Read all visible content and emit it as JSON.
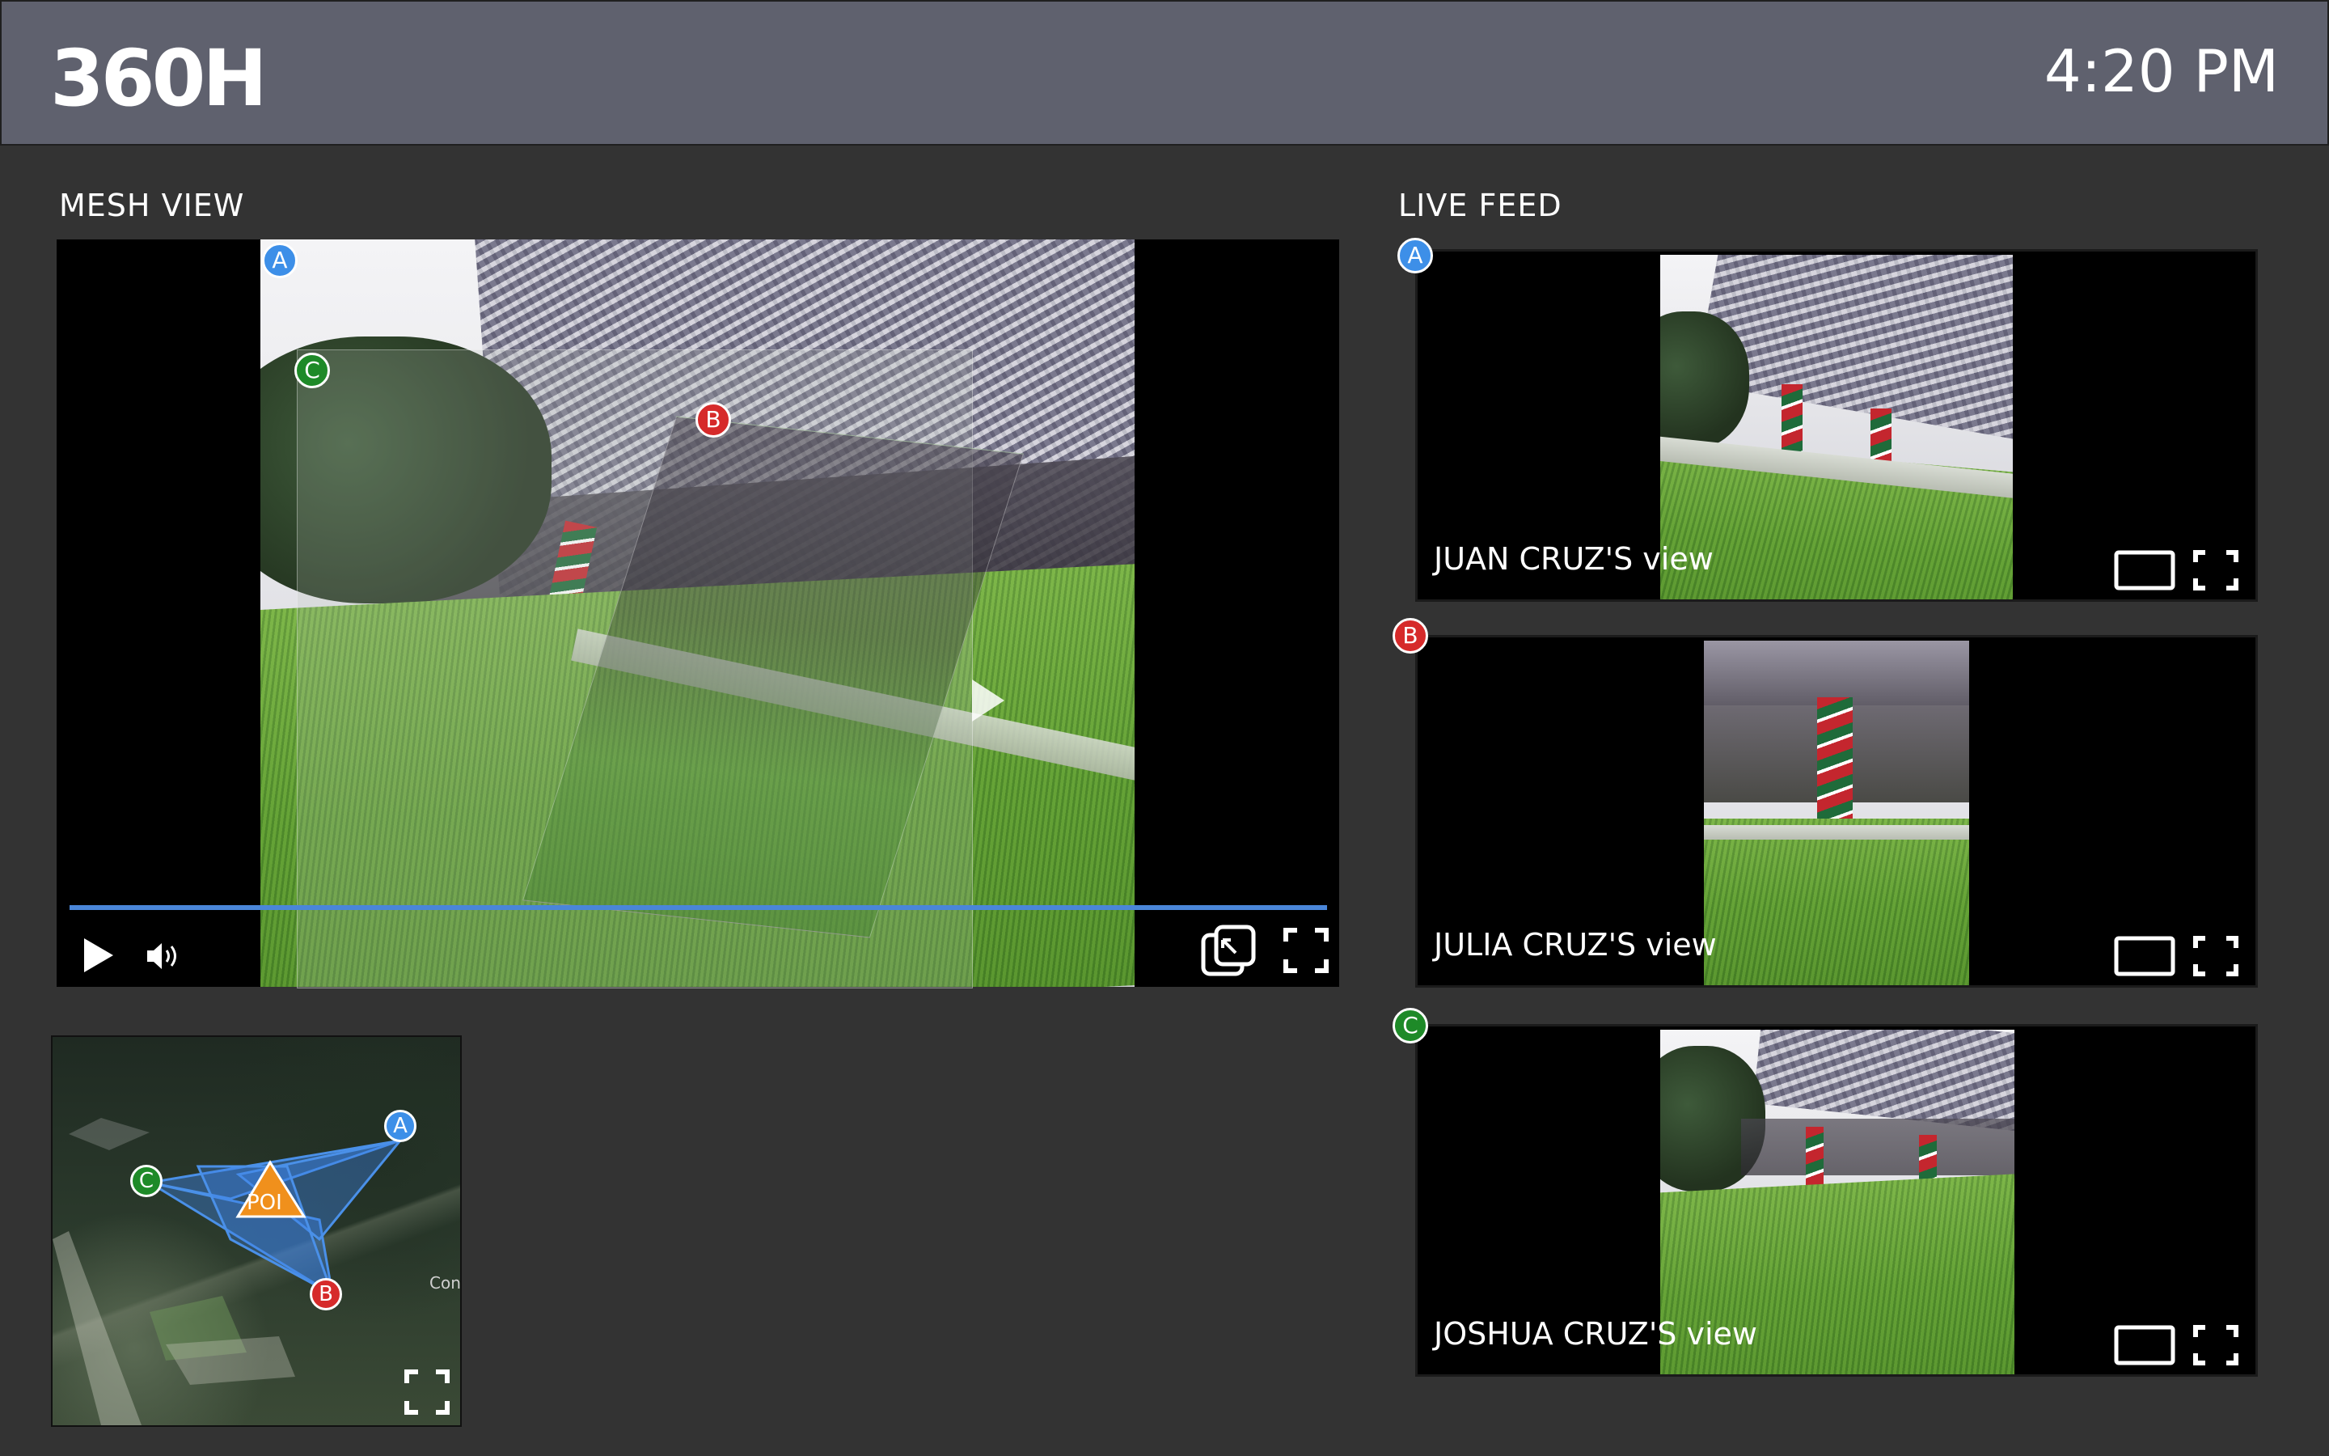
{
  "header": {
    "logo": "360H",
    "time": "4:20 PM",
    "logo_alt": "360H"
  },
  "mesh_view": {
    "title": "MESH VIEW",
    "markers": [
      "A",
      "B",
      "C"
    ],
    "progress": 1.0,
    "controls": {
      "play": "play-icon",
      "volume": "volume-icon",
      "collapse": "collapse-icon",
      "fullscreen": "fullscreen-icon"
    }
  },
  "minimap": {
    "poi_label": "POI",
    "markers": [
      "A",
      "B",
      "C"
    ],
    "map_text": "Con",
    "fullscreen": "fullscreen-icon"
  },
  "live_feed": {
    "title": "LIVE FEED",
    "feeds": [
      {
        "marker": "A",
        "label": "JUAN CRUZ'S view"
      },
      {
        "marker": "B",
        "label": "JULIA CRUZ'S view"
      },
      {
        "marker": "C",
        "label": "JOSHUA CRUZ'S view"
      }
    ]
  },
  "colors": {
    "header_bg": "#5f616e",
    "page_bg": "#333333",
    "marker_a": "#3d8fe8",
    "marker_b": "#d62a2a",
    "marker_c": "#1e8a28",
    "progress": "#4a86d8",
    "poi": "#f0901c"
  }
}
